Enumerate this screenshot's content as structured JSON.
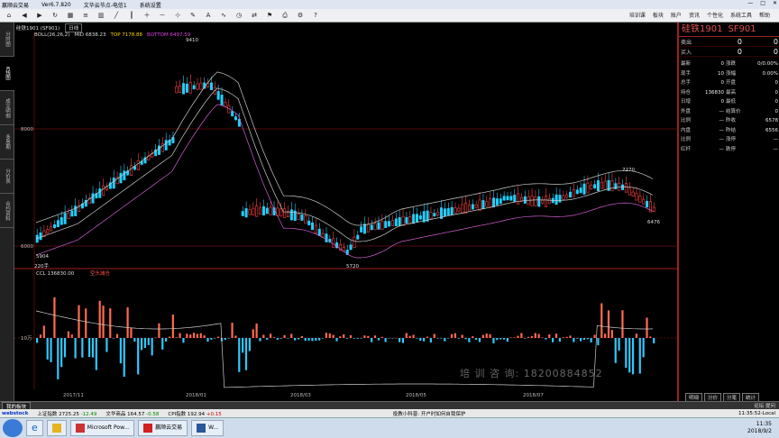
{
  "titlebar": {
    "items": [
      "赢顺云交易",
      "Ver6.7.820",
      "文华云节点-电信1",
      "系统设置"
    ]
  },
  "toolbar": {
    "menus": [
      "培训课",
      "板块",
      "账户",
      "资讯",
      "个性化",
      "系统工具",
      "帮助"
    ]
  },
  "sidetabs": [
    "分时图",
    "K线图",
    "成交明细",
    "多周期",
    "分价表",
    "合约资料"
  ],
  "chart": {
    "header": "⇔ 硅铁1901 SF901 日线",
    "contract_label": "硅铁1901 (SF901)",
    "period": "日线",
    "boll": "BOLL(26,26,2)",
    "mid_label": "MID",
    "mid_value": "6838.23",
    "top_label": "TOP",
    "top_value": "7178.88",
    "bottom_label": "BOTTOM",
    "bottom_value": "6497.59",
    "price_labels": [
      "8000",
      "6000"
    ],
    "volume_label": "CCL",
    "volume_value": "136830.00",
    "volume_legend": "空头减仓",
    "volume_axis": "10万",
    "annotations": {
      "high": "9410",
      "high2": "7270",
      "low1": "5904",
      "low2": "5720",
      "last": "6476",
      "vol_scale": "220手"
    },
    "date_labels": [
      "2017/11",
      "2018/01",
      "2018/03",
      "2018/05",
      "2018/07"
    ],
    "watermark": "培 训 咨 询: 18200884852"
  },
  "right_panel": {
    "name": "硅铁1901",
    "code": "SF901",
    "sell_label": "卖出",
    "sell_price": "0",
    "sell_qty": "0",
    "buy_label": "买入",
    "buy_price": "0",
    "buy_qty": "0",
    "quote_rows": [
      {
        "k1": "最新",
        "v1": "0",
        "k2": "涨跌",
        "v2": "0/0.00%"
      },
      {
        "k1": "现手",
        "v1": "10",
        "k2": "涨幅",
        "v2": "0.00%"
      },
      {
        "k1": "总手",
        "v1": "0",
        "k2": "开盘",
        "v2": "0"
      },
      {
        "k1": "持仓",
        "v1": "136830",
        "k2": "最高",
        "v2": "0"
      },
      {
        "k1": "日增",
        "v1": "0",
        "k2": "最低",
        "v2": "0"
      },
      {
        "k1": "外盘",
        "v1": "—",
        "k2": "结算价",
        "v2": "0"
      },
      {
        "k1": "比例",
        "v1": "—",
        "k2": "昨收",
        "v2": "6578"
      },
      {
        "k1": "内盘",
        "v1": "—",
        "k2": "昨结",
        "v2": "6556"
      },
      {
        "k1": "比例",
        "v1": "—",
        "k2": "涨停",
        "v2": "—"
      },
      {
        "k1": "红杆",
        "v1": "—",
        "k2": "跌停",
        "v2": "—"
      }
    ]
  },
  "bottom_tabs": [
    "明细",
    "分价",
    "分笔",
    "统计"
  ],
  "status": {
    "tab": "我的板块",
    "right": "论坛 提问"
  },
  "ticker": {
    "sh_label": "上证指数",
    "sh_value": "2725.25",
    "sh_change": "-12.49",
    "wh_label": "文华商品",
    "wh_value": "164.57",
    "wh_change": "-0.58",
    "cpi_label": "CPI指数",
    "cpi_value": "192.94",
    "cpi_change": "+0.15",
    "news": "投教小科普: 开户时如何自我保护",
    "time": "11:35:52-Local"
  },
  "taskbar": {
    "apps": [
      "Microsoft Pow...",
      "赢顺云交易",
      "W..."
    ],
    "time": "11:35",
    "date": "2018/9/2"
  }
}
